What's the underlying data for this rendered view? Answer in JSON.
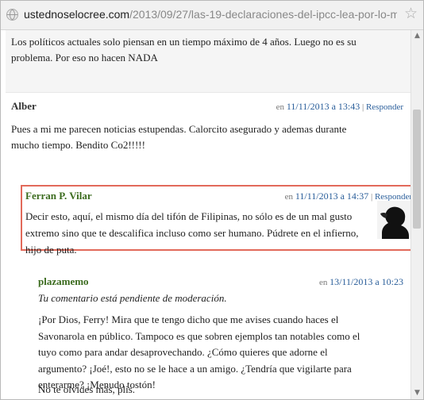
{
  "browser": {
    "url_host": "ustednoselocree.com",
    "url_path": "/2013/09/27/las-19-declaraciones-del-ipcc-lea-por-lo-menc"
  },
  "comments": [
    {
      "text": "Los políticos actuales solo piensan en un tiempo máximo de 4 años. Luego no es su problema. Por eso no hacen NADA"
    },
    {
      "author": "Alber",
      "prefix": "en",
      "date": "11/11/2013 a 13:43",
      "separator": "|",
      "reply": "Responder",
      "text": "Pues a mi me parecen noticias estupendas. Calorcito asegurado y ademas durante mucho tiempo. Bendito Co2!!!!!"
    },
    {
      "author": "Ferran P. Vilar",
      "prefix": "en",
      "date": "11/11/2013 a 14:37",
      "separator": "|",
      "reply": "Responder",
      "text": "Decir esto, aquí, el mismo día del tifón de Filipinas, no sólo es de un mal gusto extremo sino que te descalifica incluso como ser humano. Púdrete en el infierno, hijo de puta."
    },
    {
      "author": "plazamemo",
      "prefix": "en",
      "date": "13/11/2013 a 10:23",
      "moderation": "Tu comentario está pendiente de moderación.",
      "text": "¡Por Dios, Ferry! Mira que te tengo dicho que me avises cuando haces el Savonarola en público. Tampoco es que sobren ejemplos tan notables como el tuyo como para andar desaprovechando. ¿Cómo quieres que adorne el argumento? ¡Joé!, esto no se le hace a un amigo. ¿Tendría que vigilarte para enterarme? ¡Menudo tostón!",
      "text2": "No te olvides más, plis."
    }
  ],
  "icons": {
    "site": "globe-icon",
    "bookmark": "star-icon",
    "avatar": "avatar-silhouette"
  },
  "colors": {
    "highlight_border": "#e26a5a",
    "link": "#2a5e9a",
    "author_green": "#3b6b1e"
  }
}
